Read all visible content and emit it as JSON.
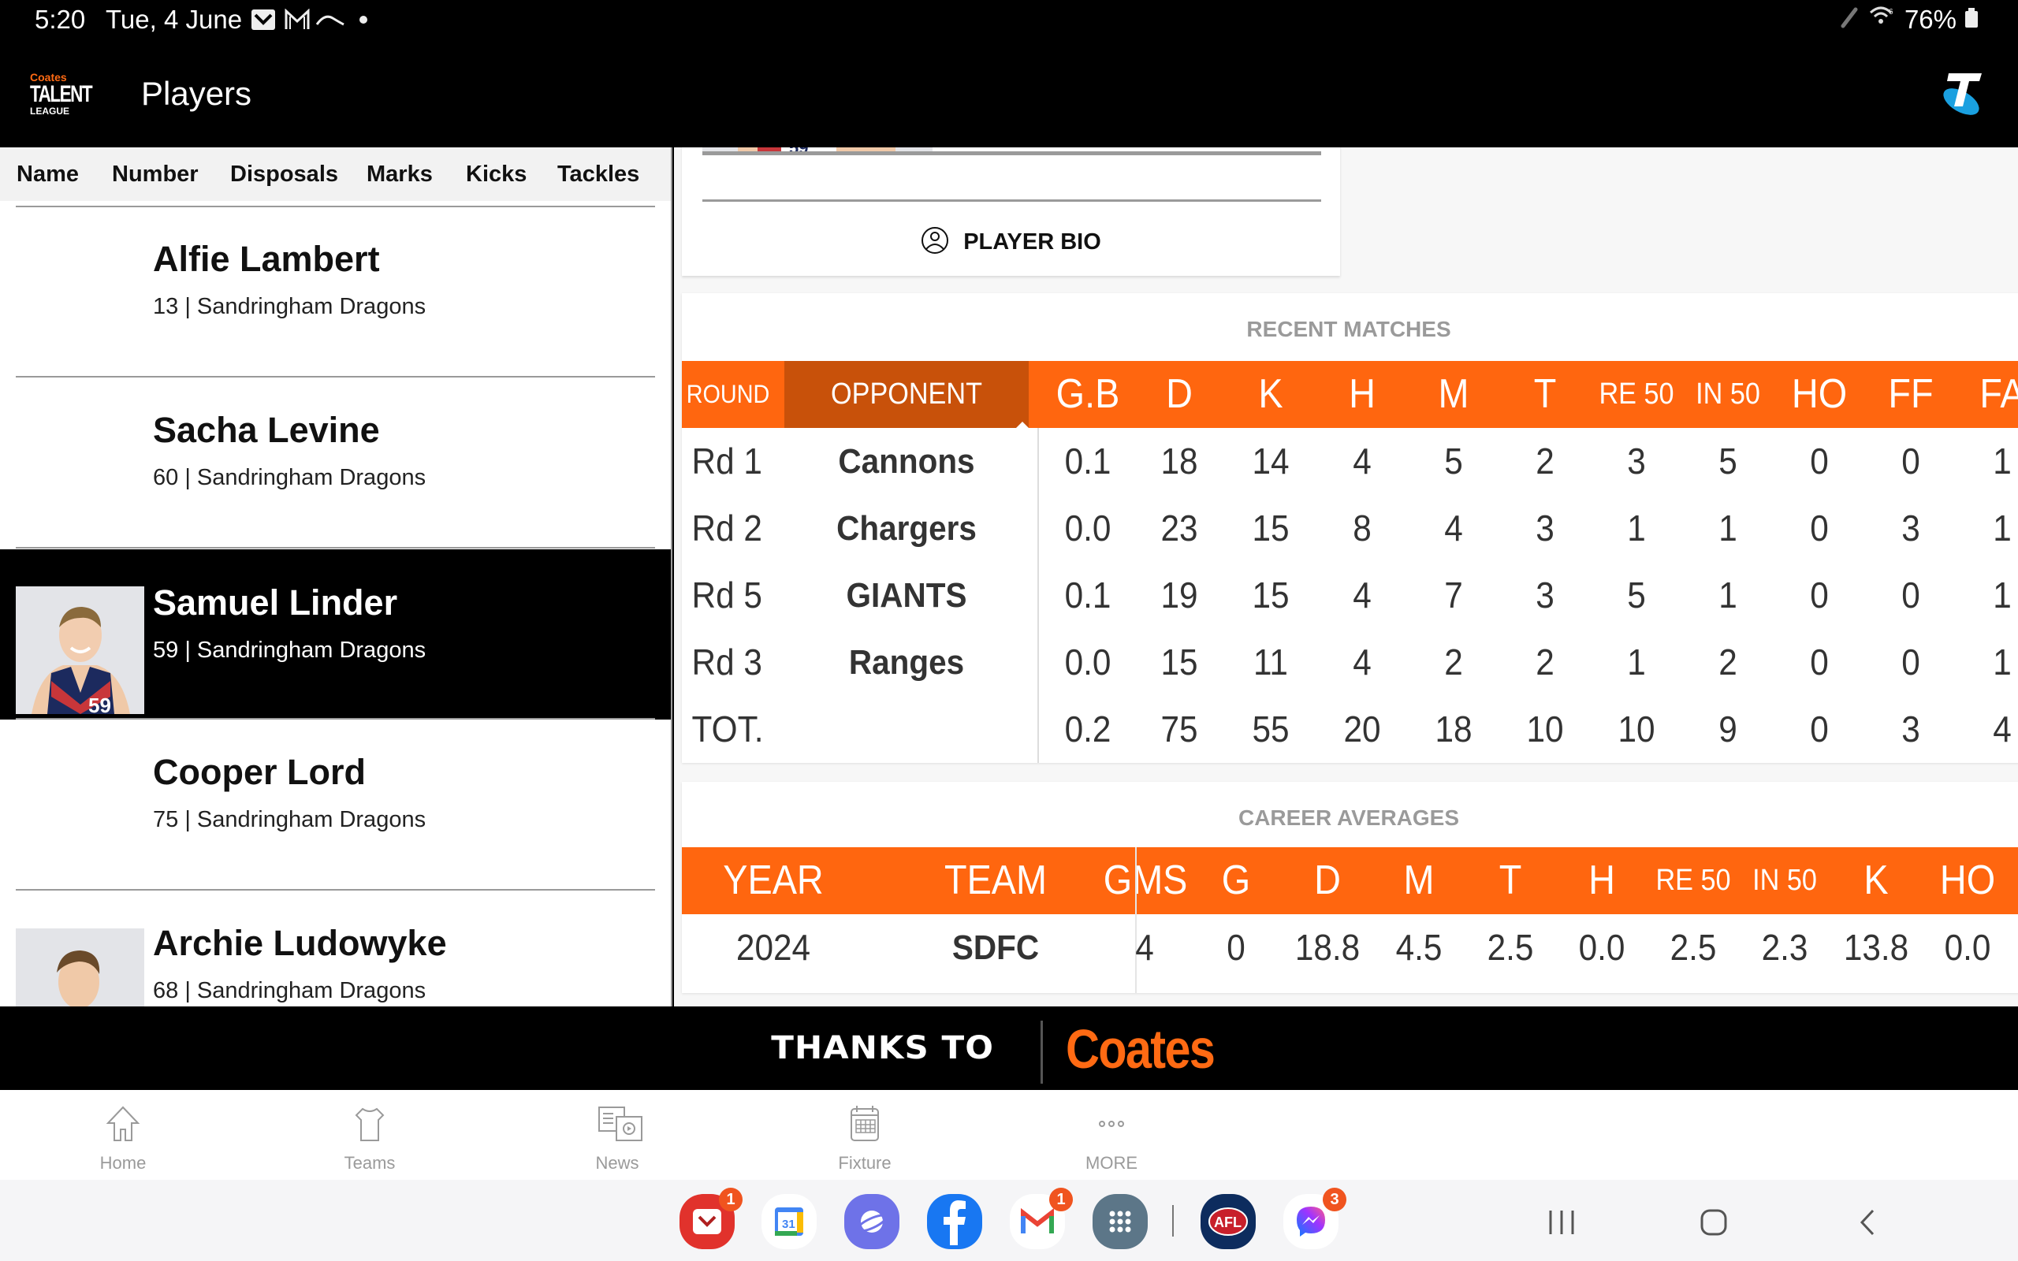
{
  "status_bar": {
    "time": "5:20",
    "date": "Tue, 4 June",
    "battery": "76%"
  },
  "app_bar": {
    "logo_top": "Coates",
    "logo_main": "TALENT",
    "logo_bottom": "LEAGUE",
    "title": "Players"
  },
  "sort_tabs": [
    "Name",
    "Number",
    "Disposals",
    "Marks",
    "Kicks",
    "Tackles"
  ],
  "players": [
    {
      "name": "Alfie Lambert",
      "meta": "13 | Sandringham Dragons",
      "selected": false,
      "photo": false
    },
    {
      "name": "Sacha Levine",
      "meta": "60 | Sandringham Dragons",
      "selected": false,
      "photo": false
    },
    {
      "name": "Samuel Linder",
      "meta": "59 | Sandringham Dragons",
      "selected": true,
      "photo": true
    },
    {
      "name": "Cooper Lord",
      "meta": "75 | Sandringham Dragons",
      "selected": false,
      "photo": false
    },
    {
      "name": "Archie Ludowyke",
      "meta": "68 | Sandringham Dragons",
      "selected": false,
      "photo": true
    }
  ],
  "bio": {
    "button_label": "PLAYER BIO"
  },
  "recent_matches": {
    "title": "RECENT MATCHES",
    "headers": [
      "ROUND",
      "OPPONENT",
      "G.B",
      "D",
      "K",
      "H",
      "M",
      "T",
      "RE 50",
      "IN 50",
      "HO",
      "FF",
      "FA"
    ],
    "rows": [
      [
        "Rd 1",
        "Cannons",
        "0.1",
        "18",
        "14",
        "4",
        "5",
        "2",
        "3",
        "5",
        "0",
        "0",
        "1"
      ],
      [
        "Rd 2",
        "Chargers",
        "0.0",
        "23",
        "15",
        "8",
        "4",
        "3",
        "1",
        "1",
        "0",
        "3",
        "1"
      ],
      [
        "Rd 5",
        "GIANTS",
        "0.1",
        "19",
        "15",
        "4",
        "7",
        "3",
        "5",
        "1",
        "0",
        "0",
        "1"
      ],
      [
        "Rd 3",
        "Ranges",
        "0.0",
        "15",
        "11",
        "4",
        "2",
        "2",
        "1",
        "2",
        "0",
        "0",
        "1"
      ],
      [
        "TOT.",
        "",
        "0.2",
        "75",
        "55",
        "20",
        "18",
        "10",
        "10",
        "9",
        "0",
        "3",
        "4"
      ]
    ]
  },
  "career_averages": {
    "title": "CAREER AVERAGES",
    "headers": [
      "YEAR",
      "TEAM",
      "GMS",
      "G",
      "D",
      "M",
      "T",
      "H",
      "RE 50",
      "IN 50",
      "K",
      "HO"
    ],
    "rows": [
      [
        "2024",
        "SDFC",
        "4",
        "0",
        "18.8",
        "4.5",
        "2.5",
        "0.0",
        "2.5",
        "2.3",
        "13.8",
        "0.0"
      ]
    ]
  },
  "sponsor": {
    "thanks": "THANKS TO",
    "brand": "Coates"
  },
  "bottom_nav": [
    {
      "label": "Home",
      "icon": "home-icon"
    },
    {
      "label": "Teams",
      "icon": "jersey-icon"
    },
    {
      "label": "News",
      "icon": "news-icon"
    },
    {
      "label": "Fixture",
      "icon": "calendar-icon"
    },
    {
      "label": "MORE",
      "icon": "more-icon"
    }
  ],
  "dock": [
    {
      "name": "pocket",
      "badge": "1"
    },
    {
      "name": "calendar",
      "badge": "",
      "text": "31"
    },
    {
      "name": "internet",
      "badge": ""
    },
    {
      "name": "facebook",
      "badge": ""
    },
    {
      "name": "gmail",
      "badge": "1"
    },
    {
      "name": "apps",
      "badge": ""
    },
    {
      "name": "afl",
      "badge": "",
      "text": "AFL"
    },
    {
      "name": "messenger",
      "badge": "3"
    }
  ],
  "colors": {
    "accent_orange": "#ff660f",
    "sorted_header": "#c8510a",
    "selected_row": "#000000"
  }
}
